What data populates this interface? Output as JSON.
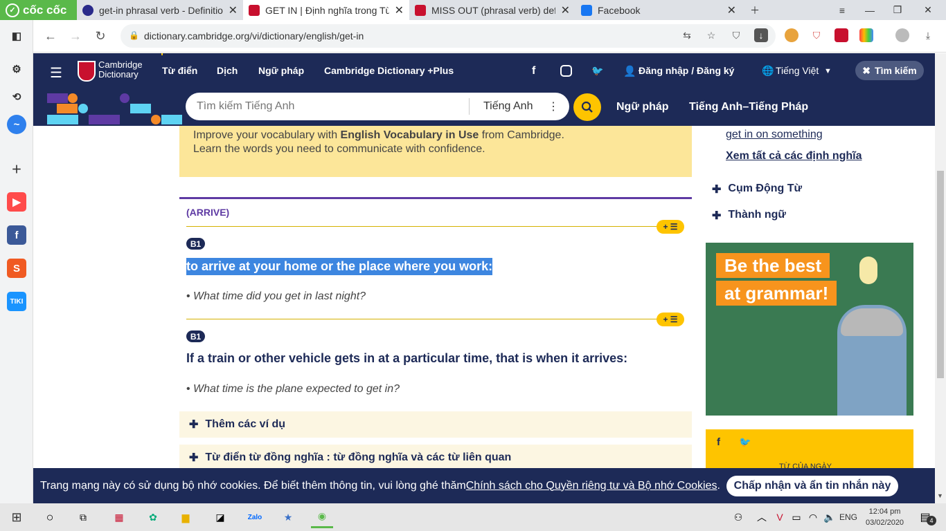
{
  "browser": {
    "brand": "cốc cốc",
    "tabs": [
      {
        "title": "get-in phrasal verb - Definitio",
        "color": "#2a2a8a"
      },
      {
        "title": "GET IN | Định nghĩa trong Từ",
        "color": "#c8102e"
      },
      {
        "title": "MISS OUT (phrasal verb) defi",
        "color": "#c8102e"
      },
      {
        "title": "Facebook",
        "color": "#1877f2"
      }
    ],
    "url": "dictionary.cambridge.org/vi/dictionary/english/get-in"
  },
  "site": {
    "logo_line1": "Cambridge",
    "logo_line2": "Dictionary",
    "nav": [
      "Từ điển",
      "Dịch",
      "Ngữ pháp",
      "Cambridge Dictionary +Plus"
    ],
    "login": "Đăng nhập / Đăng ký",
    "language": "Tiếng Việt",
    "search_close": "Tìm kiếm",
    "search_placeholder": "Tìm kiếm Tiếng Anh",
    "search_lang": "Tiếng Anh",
    "sub_nav": [
      "Ngữ pháp",
      "Tiếng Anh–Tiếng Pháp"
    ]
  },
  "promo": {
    "line1_prefix": "Improve your vocabulary with ",
    "line1_bold": "English Vocabulary in Use",
    "line1_suffix": " from Cambridge.",
    "line2": "Learn the words you need to communicate with confidence."
  },
  "entry": {
    "guideword": "(ARRIVE)",
    "plus_label": "+ ☰",
    "senses": [
      {
        "level": "B1",
        "definition": "to arrive at your home or the place where you work:",
        "example": "What time did you get in last night?"
      },
      {
        "level": "B1",
        "definition": "If a train or other vehicle gets in at a particular time, that is when it arrives:",
        "example": "What time is the plane expected to get in?"
      }
    ],
    "more_examples": "Thêm các ví dụ",
    "thesaurus": "Từ điển từ đồng nghĩa : từ đồng nghĩa và các từ liên quan"
  },
  "sidebar": {
    "link1": "get in on something",
    "see_all": "Xem tất cả các định nghĩa",
    "acc1": "Cụm Động Từ",
    "acc2": "Thành ngữ",
    "ad_line1": "Be the best",
    "ad_line2": "at grammar!",
    "wod": "TỪ CỦA NGÀY"
  },
  "cookie": {
    "text": "Trang mạng này có sử dụng bộ nhớ cookies. Để biết thêm thông tin, vui lòng ghé thăm ",
    "link": "Chính sách cho Quyền riêng tư và Bộ nhớ Cookies",
    "end": ".",
    "button": "Chấp nhận và ẩn tin nhắn này"
  },
  "taskbar": {
    "lang": "ENG",
    "time": "12:04 pm",
    "date": "03/02/2020",
    "notif_count": "4"
  }
}
